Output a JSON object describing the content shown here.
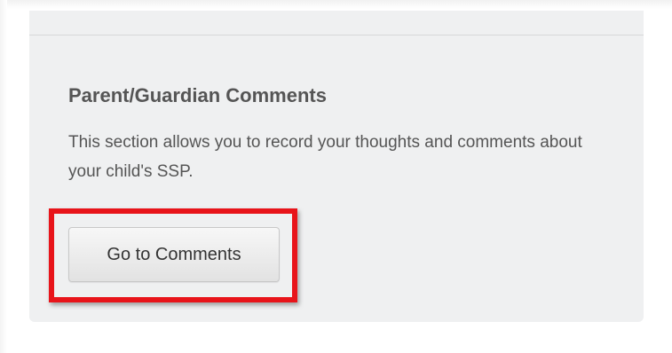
{
  "section": {
    "title": "Parent/Guardian Comments",
    "description": "This section allows you to record your thoughts and comments about your child's SSP.",
    "button_label": "Go to Comments"
  },
  "colors": {
    "panel_background": "#eff0f1",
    "text": "#555555",
    "highlight": "#e8141a"
  }
}
